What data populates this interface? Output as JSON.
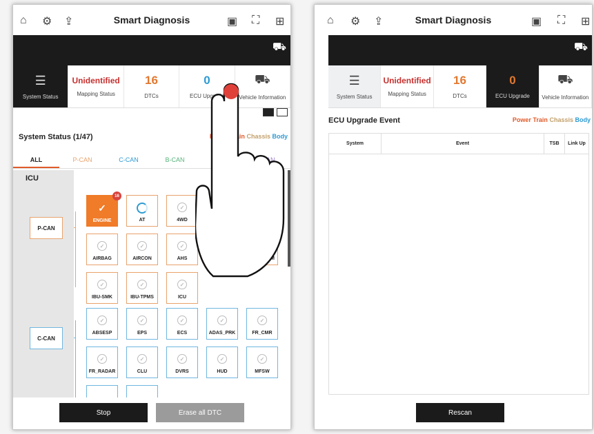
{
  "app": {
    "title": "Smart Diagnosis"
  },
  "tabs": [
    {
      "value": "",
      "label": "System Status"
    },
    {
      "value": "Unidentified",
      "label": "Mapping Status"
    },
    {
      "value": "16",
      "label": "DTCs"
    },
    {
      "value": "0",
      "label": "ECU Upgrade"
    },
    {
      "value": "",
      "label": "Vehicle Information"
    }
  ],
  "left": {
    "section_title": "System Status (1/47)",
    "legend": {
      "power_train": "Power Train",
      "chassis": "Chassis",
      "body": "Body"
    },
    "can_filters": [
      "ALL",
      "P-CAN",
      "C-CAN",
      "B-CAN",
      "",
      "-CAN"
    ],
    "side_label": "ICU",
    "buses": [
      "P-CAN",
      "C-CAN"
    ],
    "ecus_pcan": [
      "ENGINE",
      "AT",
      "4WD",
      "AIRBAG",
      "AIRCON",
      "AHS",
      "M",
      "IBU-SMK",
      "IBU-TPMS",
      "ICU"
    ],
    "ecus_ccan": [
      "ABSESP",
      "EPS",
      "ECS",
      "ADAS_PRK",
      "FR_CMR",
      "FR_RADAR",
      "CLU",
      "DVRS",
      "HUD",
      "MFSW"
    ],
    "engine_badge": "16",
    "buttons": {
      "stop": "Stop",
      "erase": "Erase all DTC"
    }
  },
  "right": {
    "section_title": "ECU Upgrade Event",
    "legend": {
      "power_train": "Power Train",
      "chassis": "Chassis",
      "body": "Body"
    },
    "columns": [
      "System",
      "Event",
      "TSB",
      "Link Up"
    ],
    "buttons": {
      "rescan": "Rescan"
    }
  },
  "colors": {
    "accent_orange": "#f07b28",
    "dark": "#1b1b1b",
    "red": "#c5312f",
    "blue": "#2d9ad3"
  },
  "icons": [
    "home-icon",
    "settings-icon",
    "export-icon",
    "battery-icon",
    "expand-icon",
    "grid-icon",
    "car-icon",
    "checklist-icon",
    "vehicle-info-icon"
  ]
}
